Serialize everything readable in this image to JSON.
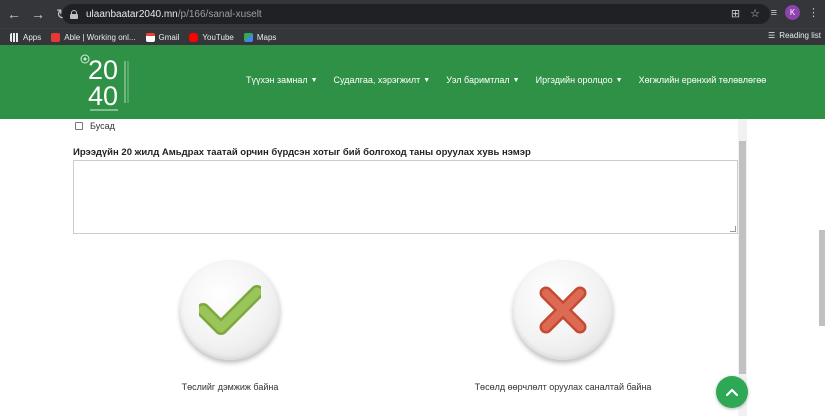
{
  "browser": {
    "url_host": "ulaanbaatar2040.mn",
    "url_path": "/p/166/sanal-xuselt",
    "profile_initial": "K"
  },
  "bookmarks": {
    "items": [
      {
        "label": "Apps",
        "icon": "apps-grid-icon",
        "color": "#e8eaed"
      },
      {
        "label": "Able | Working onl...",
        "icon": "able-icon",
        "color": "#e53935"
      },
      {
        "label": "Gmail",
        "icon": "gmail-icon",
        "color": "#ea4335"
      },
      {
        "label": "YouTube",
        "icon": "youtube-icon",
        "color": "#ff0000"
      },
      {
        "label": "Maps",
        "icon": "maps-icon",
        "color": "#34a853"
      }
    ],
    "reading_list": "Reading list"
  },
  "site": {
    "brand_color": "#2e9146",
    "logo_digits_top": "20",
    "logo_digits_bottom": "40",
    "nav": [
      {
        "label": "Түүхэн замнал"
      },
      {
        "label": "Судалгаа, хэрэгжилт"
      },
      {
        "label": "Уэл баримтлал"
      },
      {
        "label": "Иргэдийн оролцоо"
      },
      {
        "label": "Хөгжлийн ерөнхий төлөвлөгөө"
      }
    ]
  },
  "form": {
    "checkbox_label": "Бусад",
    "question": "Ирээдүйн 20 жилд Амьдрах таатай орчин бүрдсэн хотыг бий болгоход таны оруулах хувь нэмэр",
    "answer_value": ""
  },
  "choices": {
    "approve_label": "Төслийг дэмжиж байна",
    "reject_label": "Төсөлд өөрчлөлт оруулах саналтай байна",
    "approve_color": "#8dba4e",
    "reject_color": "#d65a42"
  }
}
